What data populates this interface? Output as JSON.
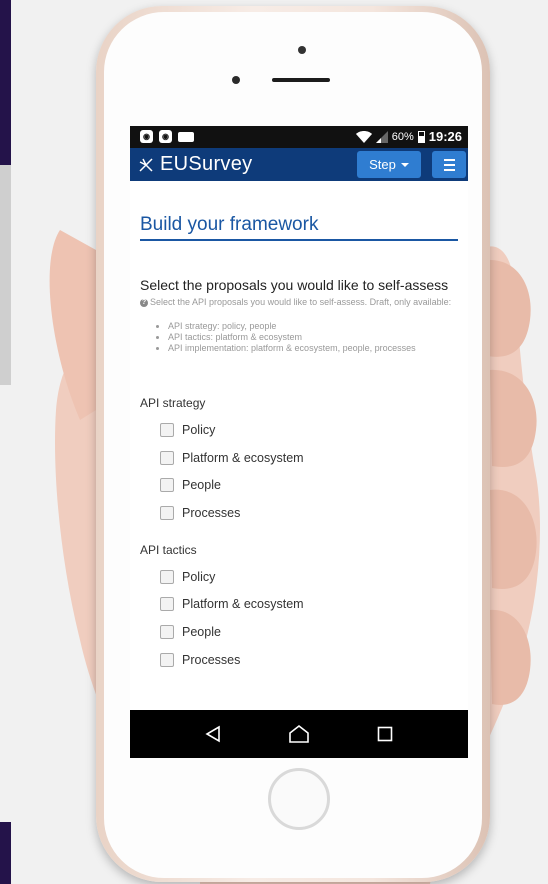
{
  "status_bar": {
    "left_icons": [
      "notification-icon",
      "notification-icon",
      "sim-icon"
    ],
    "battery_percent": "60%",
    "time": "19:26"
  },
  "navbar": {
    "logo_text": "EUSurvey",
    "step_label": "Step",
    "menu_icon": "hamburger-icon"
  },
  "page": {
    "title": "Build your framework",
    "question": "Select the proposals you would like to self-assess",
    "help_text": "Select the API proposals you would like to self-assess. Draft, only available:",
    "help_items": [
      "API strategy: policy, people",
      "API tactics: platform & ecosystem",
      "API implementation: platform & ecosystem, people, processes"
    ],
    "sections": [
      {
        "label": "API strategy",
        "options": [
          "Policy",
          "Platform & ecosystem",
          "People",
          "Processes"
        ]
      },
      {
        "label": "API tactics",
        "options": [
          "Policy",
          "Platform & ecosystem",
          "People",
          "Processes"
        ]
      }
    ]
  },
  "android_nav": [
    "back-icon",
    "home-icon",
    "recents-icon"
  ],
  "colors": {
    "navbar": "#0e3b7a",
    "button": "#2f7dd1",
    "title": "#1a57a3",
    "stripe": "#24134a"
  }
}
